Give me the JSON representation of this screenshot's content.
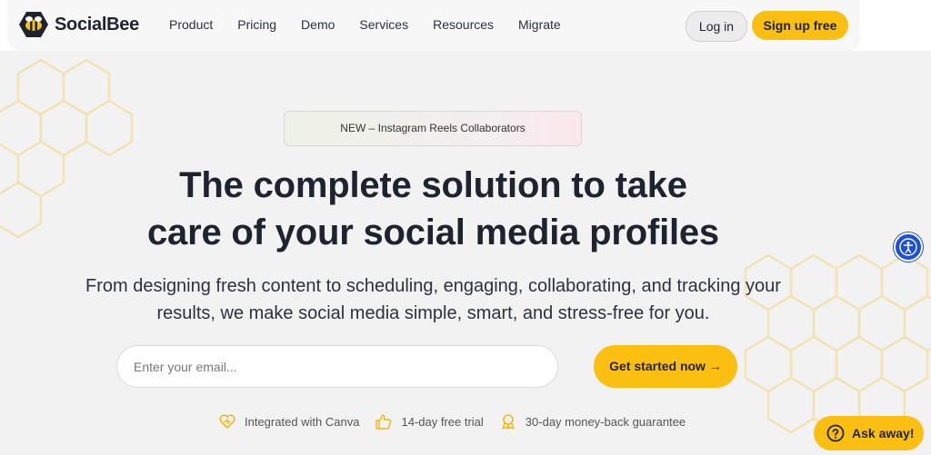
{
  "brand": {
    "name": "SocialBee",
    "accent": "#fbbf12",
    "text_color": "#1e2330",
    "logo_icon": "bee-logo-icon"
  },
  "nav": {
    "items": [
      "Product",
      "Pricing",
      "Demo",
      "Services",
      "Resources",
      "Migrate"
    ],
    "login_label": "Log in",
    "signup_label": "Sign up free"
  },
  "hero": {
    "badge": "NEW – Instagram Reels Collaborators",
    "headline_line1": "The complete solution to take",
    "headline_line2": "care of your social media profiles",
    "subtitle_line1": "From designing fresh content to scheduling, engaging, collaborating, and tracking your",
    "subtitle_line2": "results, we make social media simple, smart, and stress-free for you.",
    "email_placeholder": "Enter your email...",
    "cta_label": "Get started now →"
  },
  "features": [
    {
      "icon": "canva-heart-icon",
      "label": "Integrated with Canva"
    },
    {
      "icon": "thumbs-up-icon",
      "label": "14-day free trial"
    },
    {
      "icon": "award-ribbon-icon",
      "label": "30-day money-back guarantee"
    }
  ],
  "widgets": {
    "accessibility_icon": "accessibility-icon",
    "accessibility_color": "#1a4fd6",
    "chat_label": "Ask away!",
    "chat_icon": "question-circle-icon"
  }
}
